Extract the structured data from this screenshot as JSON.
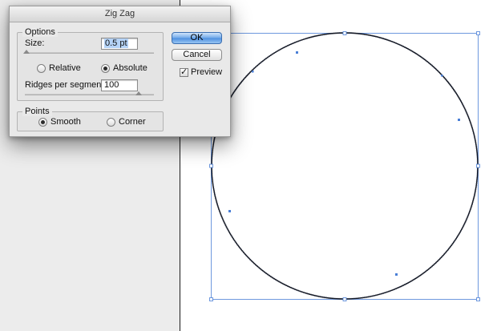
{
  "dialog": {
    "title": "Zig Zag",
    "options_group_label": "Options",
    "size_label": "Size:",
    "size_value": "0.5 pt",
    "size_slider_fraction": 0.0,
    "relative_label": "Relative",
    "absolute_label": "Absolute",
    "size_mode_selected": "Absolute",
    "ridges_label": "Ridges per segment:",
    "ridges_value": "100",
    "ridges_slider_fraction": 1.0,
    "points_group_label": "Points",
    "smooth_label": "Smooth",
    "corner_label": "Corner",
    "points_selected": "Smooth",
    "ok_label": "OK",
    "cancel_label": "Cancel",
    "preview_label": "Preview",
    "preview_checked": true
  },
  "canvas": {
    "selection_color": "#4a7fd6",
    "stroke_color": "#111111",
    "pasteboard_color": "#ececec",
    "shape": "circle-with-zigzag-effect"
  }
}
